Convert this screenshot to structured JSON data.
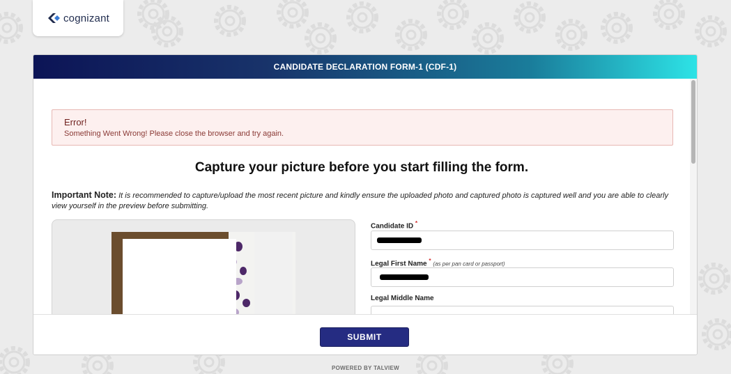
{
  "brand": {
    "logo_text": "cognizant"
  },
  "form": {
    "title": "CANDIDATE DECLARATION FORM-1 (CDF-1)",
    "error": {
      "title": "Error!",
      "message": "Something Went Wrong! Please close the browser and try again."
    },
    "capture_heading": "Capture your picture before you start filling the form.",
    "note": {
      "label": "Important Note:",
      "text": "It is recommended to capture/upload the most recent picture and kindly ensure the uploaded photo and captured photo is captured well and you are able to clearly view yourself in the preview before submitting."
    },
    "fields": {
      "candidate_id": {
        "label": "Candidate ID",
        "required": "*"
      },
      "legal_first_name": {
        "label": "Legal First Name",
        "required": "*",
        "hint": "(as per pan card or passport)"
      },
      "legal_middle_name": {
        "label": "Legal Middle Name"
      }
    },
    "submit_label": "SUBMIT"
  },
  "footer": {
    "powered_by": "POWERED BY TALVIEW"
  },
  "colors": {
    "header_start": "#0c1456",
    "header_end": "#2de3e6",
    "submit": "#252c82",
    "error_bg": "#fdf0ef",
    "required": "#d32f2f"
  }
}
